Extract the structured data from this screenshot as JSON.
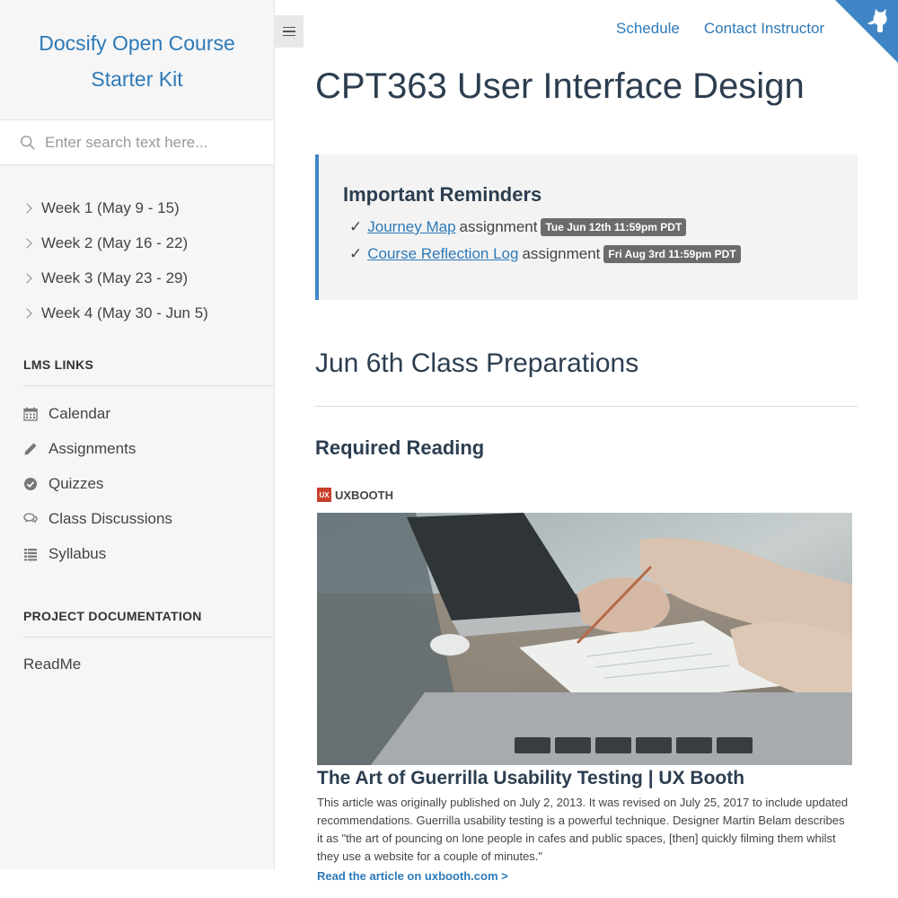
{
  "sidebar": {
    "app_name_line1": "Docsify Open Course",
    "app_name_line2": "Starter Kit",
    "search_placeholder": "Enter search text here...",
    "weeks": [
      {
        "label": "Week 1 (May 9 - 15)"
      },
      {
        "label": "Week 2 (May 16 - 22)"
      },
      {
        "label": "Week 3 (May 23 - 29)"
      },
      {
        "label": "Week 4 (May 30 - Jun 5)"
      }
    ],
    "lms_title": "LMS LINKS",
    "lms_links": [
      {
        "label": "Calendar",
        "icon": "calendar-icon"
      },
      {
        "label": "Assignments",
        "icon": "pencil-icon"
      },
      {
        "label": "Quizzes",
        "icon": "check-circle-icon"
      },
      {
        "label": "Class Discussions",
        "icon": "comments-icon"
      },
      {
        "label": "Syllabus",
        "icon": "list-icon"
      }
    ],
    "project_title": "PROJECT DOCUMENTATION",
    "readme": "ReadMe"
  },
  "topnav": {
    "schedule": "Schedule",
    "contact": "Contact Instructor"
  },
  "main": {
    "title": "CPT363 User Interface Design",
    "reminders": {
      "heading": "Important Reminders",
      "items": [
        {
          "check": "✓",
          "link": "Journey Map",
          "word": "assignment",
          "due": "Tue Jun 12th 11:59pm PDT"
        },
        {
          "check": "✓",
          "link": "Course Reflection Log",
          "word": "assignment",
          "due": "Fri Aug 3rd 11:59pm PDT"
        }
      ]
    },
    "section_title": "Jun 6th Class Preparations",
    "required_reading": "Required Reading",
    "card": {
      "site_logo_text": "UX",
      "site_name": "UXBOOTH",
      "title": "The Art of Guerrilla Usability Testing | UX Booth",
      "description": "This article was originally published on July 2, 2013. It was revised on July 25, 2017 to include updated recommendations. Guerrilla usability testing is a powerful technique. Designer Martin Belam describes it as \"the art of pouncing on lone people in cafes and public spaces, [then] quickly filming them whilst they use a website for a couple of minutes.\"",
      "link": "Read the article on uxbooth.com >"
    }
  },
  "colors": {
    "accent": "#2d7ab8",
    "sidebar_bg": "#f6f6f6",
    "tip_border": "#3f85c6",
    "badge_bg": "#6b6b6b"
  }
}
